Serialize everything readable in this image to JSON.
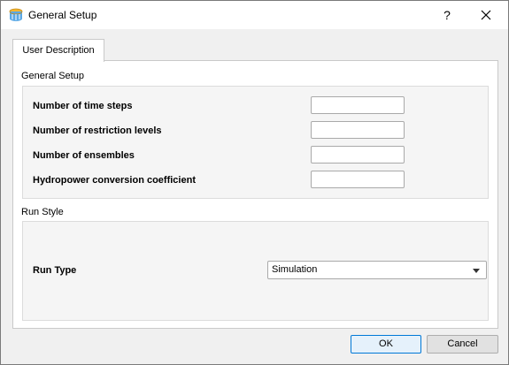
{
  "window": {
    "title": "General Setup",
    "help_label": "?",
    "app_icon": "database-icon",
    "close_icon": "close-icon"
  },
  "tabs": [
    {
      "label": "User Description",
      "selected": true
    }
  ],
  "general_setup": {
    "heading": "General Setup",
    "fields": [
      {
        "label": "Number of time steps",
        "value": ""
      },
      {
        "label": "Number of restriction levels",
        "value": ""
      },
      {
        "label": "Number of ensembles",
        "value": ""
      },
      {
        "label": "Hydropower conversion coefficient",
        "value": ""
      }
    ]
  },
  "run_style": {
    "heading": "Run Style",
    "run_type_label": "Run Type",
    "run_type_value": "Simulation",
    "dropdown_icon": "chevron-down-icon"
  },
  "buttons": {
    "ok": "OK",
    "cancel": "Cancel"
  },
  "colors": {
    "accent": "#0078d7",
    "panel_bg": "#ffffff",
    "group_bg": "#f5f5f5",
    "window_bg": "#f0f0f0"
  }
}
